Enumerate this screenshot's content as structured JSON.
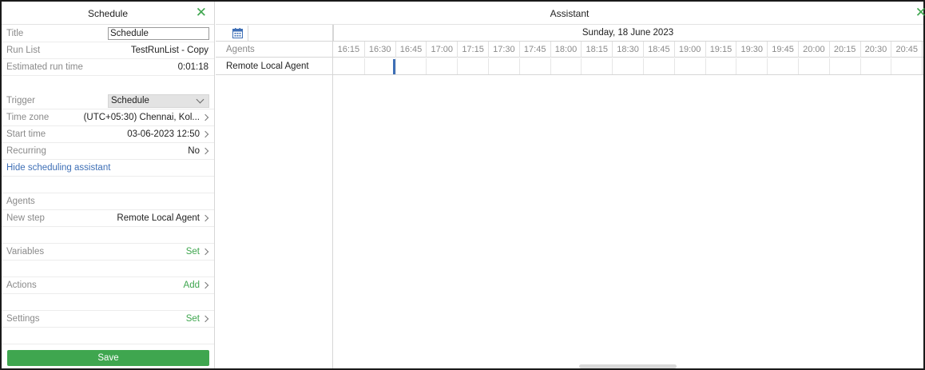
{
  "schedule_panel": {
    "title": "Schedule",
    "close_icon": "close-icon",
    "fields": {
      "title_label": "Title",
      "title_value": "Schedule",
      "run_list_label": "Run List",
      "run_list_value": "TestRunList - Copy",
      "est_run_time_label": "Estimated run time",
      "est_run_time_value": "0:01:18",
      "trigger_label": "Trigger",
      "trigger_value": "Schedule",
      "time_zone_label": "Time zone",
      "time_zone_value": "(UTC+05:30) Chennai, Kol...",
      "start_time_label": "Start time",
      "start_time_value": "03-06-2023 12:50",
      "recurring_label": "Recurring",
      "recurring_value": "No",
      "hide_assistant_link": "Hide scheduling assistant",
      "agents_label": "Agents",
      "new_step_label": "New step",
      "new_step_value": "Remote Local Agent",
      "variables_label": "Variables",
      "variables_action": "Set",
      "actions_label": "Actions",
      "actions_action": "Add",
      "settings_label": "Settings",
      "settings_action": "Set"
    },
    "save_label": "Save"
  },
  "assistant_panel": {
    "title": "Assistant",
    "close_icon": "close-icon",
    "calendar_icon": "calendar-icon",
    "date": "Sunday, 18 June 2023",
    "agents_header": "Agents",
    "times": [
      "16:15",
      "16:30",
      "16:45",
      "17:00",
      "17:15",
      "17:30",
      "17:45",
      "18:00",
      "18:15",
      "18:30",
      "18:45",
      "19:00",
      "19:15",
      "19:30",
      "19:45",
      "20:00",
      "20:15",
      "20:30",
      "20:45"
    ],
    "agents": [
      "Remote Local Agent"
    ]
  },
  "colors": {
    "accent_green": "#3fa64f",
    "link_blue": "#3e6fb6",
    "marker_blue": "#3e6fb6"
  }
}
